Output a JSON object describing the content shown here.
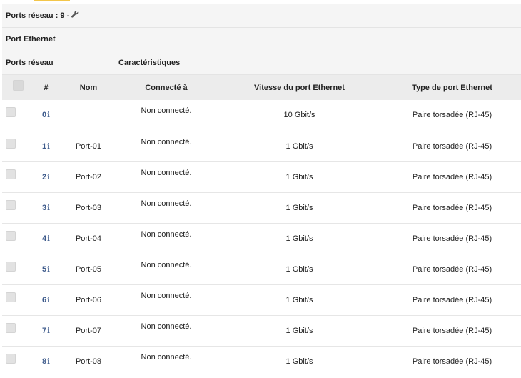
{
  "header": {
    "title": "Ports réseau : 9 - ",
    "wrench_icon": "wrench-icon"
  },
  "section": {
    "ethernet_label": "Port Ethernet",
    "ports_label": "Ports réseau",
    "characteristics_label": "Caractéristiques"
  },
  "table": {
    "columns": [
      "#",
      "Nom",
      "Connecté à",
      "Vitesse du port Ethernet",
      "Type de port Ethernet"
    ],
    "rows": [
      {
        "num": "0",
        "name": "",
        "connected": "Non connecté.",
        "speed": "10 Gbit/s",
        "type": "Paire torsadée (RJ-45)"
      },
      {
        "num": "1",
        "name": "Port-01",
        "connected": "Non connecté.",
        "speed": "1 Gbit/s",
        "type": "Paire torsadée (RJ-45)"
      },
      {
        "num": "2",
        "name": "Port-02",
        "connected": "Non connecté.",
        "speed": "1 Gbit/s",
        "type": "Paire torsadée (RJ-45)"
      },
      {
        "num": "3",
        "name": "Port-03",
        "connected": "Non connecté.",
        "speed": "1 Gbit/s",
        "type": "Paire torsadée (RJ-45)"
      },
      {
        "num": "4",
        "name": "Port-04",
        "connected": "Non connecté.",
        "speed": "1 Gbit/s",
        "type": "Paire torsadée (RJ-45)"
      },
      {
        "num": "5",
        "name": "Port-05",
        "connected": "Non connecté.",
        "speed": "1 Gbit/s",
        "type": "Paire torsadée (RJ-45)"
      },
      {
        "num": "6",
        "name": "Port-06",
        "connected": "Non connecté.",
        "speed": "1 Gbit/s",
        "type": "Paire torsadée (RJ-45)"
      },
      {
        "num": "7",
        "name": "Port-07",
        "connected": "Non connecté.",
        "speed": "1 Gbit/s",
        "type": "Paire torsadée (RJ-45)"
      },
      {
        "num": "8",
        "name": "Port-08",
        "connected": "Non connecté.",
        "speed": "1 Gbit/s",
        "type": "Paire torsadée (RJ-45)"
      }
    ]
  },
  "colors": {
    "accent": "#f3c64a",
    "link": "#3e5b8c",
    "header_bg": "#f5f5f5"
  }
}
